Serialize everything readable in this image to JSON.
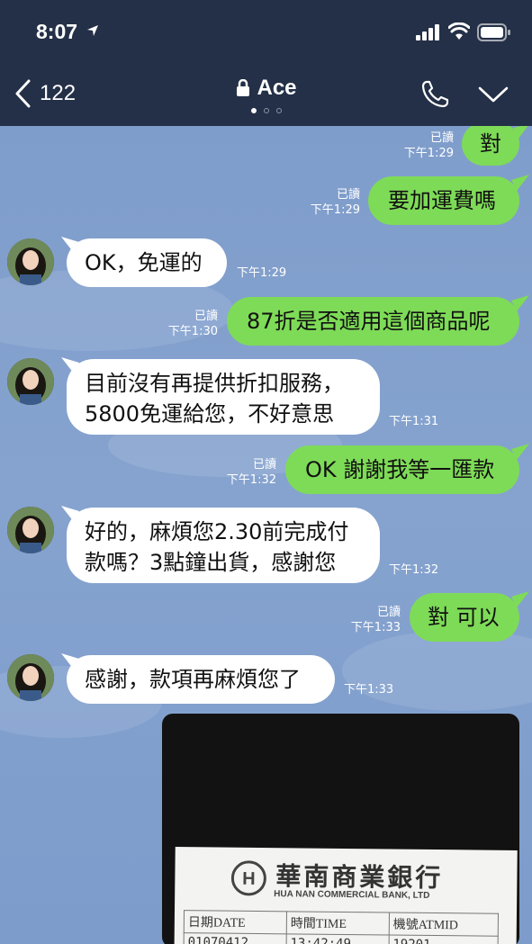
{
  "status_bar": {
    "time": "8:07"
  },
  "nav": {
    "back_count": "122",
    "title": "Ace"
  },
  "messages": [
    {
      "id": "m1",
      "dir": "out",
      "text": "對",
      "read": "已讀",
      "time": "下午1:29"
    },
    {
      "id": "m2",
      "dir": "out",
      "text": "要加運費嗎",
      "read": "已讀",
      "time": "下午1:29"
    },
    {
      "id": "m3",
      "dir": "in",
      "text": "OK，免運的",
      "time": "下午1:29"
    },
    {
      "id": "m4",
      "dir": "out",
      "text": "87折是否適用這個商品呢",
      "read": "已讀",
      "time": "下午1:30"
    },
    {
      "id": "m5",
      "dir": "in",
      "text": "目前沒有再提供折扣服務，\n5800免運給您，不好意思",
      "time": "下午1:31"
    },
    {
      "id": "m6",
      "dir": "out",
      "text": "OK 謝謝我等一匯款",
      "read": "已讀",
      "time": "下午1:32"
    },
    {
      "id": "m7",
      "dir": "in",
      "text": "好的，麻煩您2.30前完成付\n款嗎？3點鐘出貨，感謝您",
      "time": "下午1:32"
    },
    {
      "id": "m8",
      "dir": "out",
      "text": "對 可以",
      "read": "已讀",
      "time": "下午1:33"
    },
    {
      "id": "m9",
      "dir": "in",
      "text": "感謝，款項再麻煩您了",
      "time": "下午1:33"
    }
  ],
  "photo": {
    "bank_name_zh": "華南商業銀行",
    "bank_name_en": "HUA NAN COMMERCIAL BANK, LTD",
    "headers": [
      "日期DATE",
      "時間TIME",
      "機號ATMID"
    ],
    "values": [
      "01070412",
      "13:42:49",
      "19201"
    ]
  },
  "colors": {
    "header_bg": "#243047",
    "outgoing_bubble": "#7edb57",
    "incoming_bubble": "#ffffff",
    "chat_bg": "#7b9ac8"
  },
  "icons": [
    "location-arrow-icon",
    "signal-icon",
    "wifi-icon",
    "battery-icon",
    "back-chevron-icon",
    "lock-icon",
    "phone-icon",
    "chevron-down-icon",
    "avatar"
  ]
}
